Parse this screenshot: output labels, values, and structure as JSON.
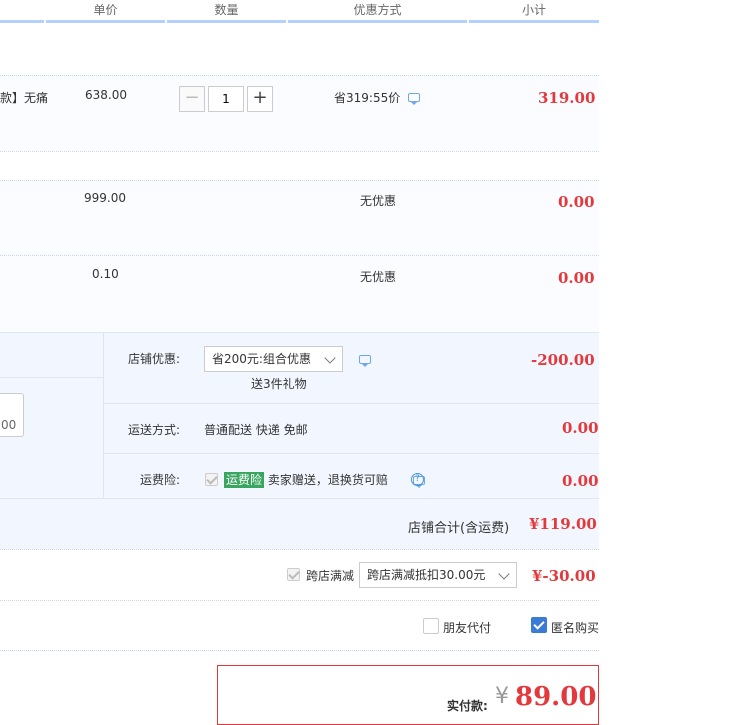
{
  "header": {
    "unit_price": "单价",
    "quantity": "数量",
    "discount": "优惠方式",
    "subtotal": "小计"
  },
  "items": [
    {
      "title_fragment": "款】无痛",
      "price": "638.00",
      "quantity": "1",
      "promo": "省319:55价",
      "subtotal": "319.00"
    },
    {
      "price": "999.00",
      "promo": "无优惠",
      "subtotal": "0.00"
    },
    {
      "price": "0.10",
      "promo": "无优惠",
      "subtotal": "0.00"
    }
  ],
  "shop": {
    "input_fragment": "00",
    "coupon_label": "店铺优惠:",
    "coupon_value": "省200元:组合优惠",
    "coupon_gift": "送3件礼物",
    "coupon_amount": "-200.00",
    "shipping_label": "运送方式:",
    "shipping_value": "普通配送 快递 免邮",
    "shipping_amount": "0.00",
    "insurance_label": "运费险:",
    "insurance_tag": "运费险",
    "insurance_text": "卖家赠送，退换货可赔",
    "insurance_amount": "0.00",
    "total_label": "店铺合计(含运费)",
    "total_amount": "¥119.00"
  },
  "cross_store": {
    "label": "跨店满减",
    "select_value": "跨店满减抵扣30.00元",
    "amount": "¥-30.00"
  },
  "options": {
    "friend_pay": "朋友代付",
    "anonymous": "匿名购买"
  },
  "payment": {
    "label": "实付款:",
    "currency": "¥",
    "amount": "89.00"
  },
  "colors": {
    "accent_red": "#e4393c",
    "header_line": "#b2d1ff",
    "checkbox_blue": "#3a7bd5",
    "insurance_green": "#39a660"
  }
}
